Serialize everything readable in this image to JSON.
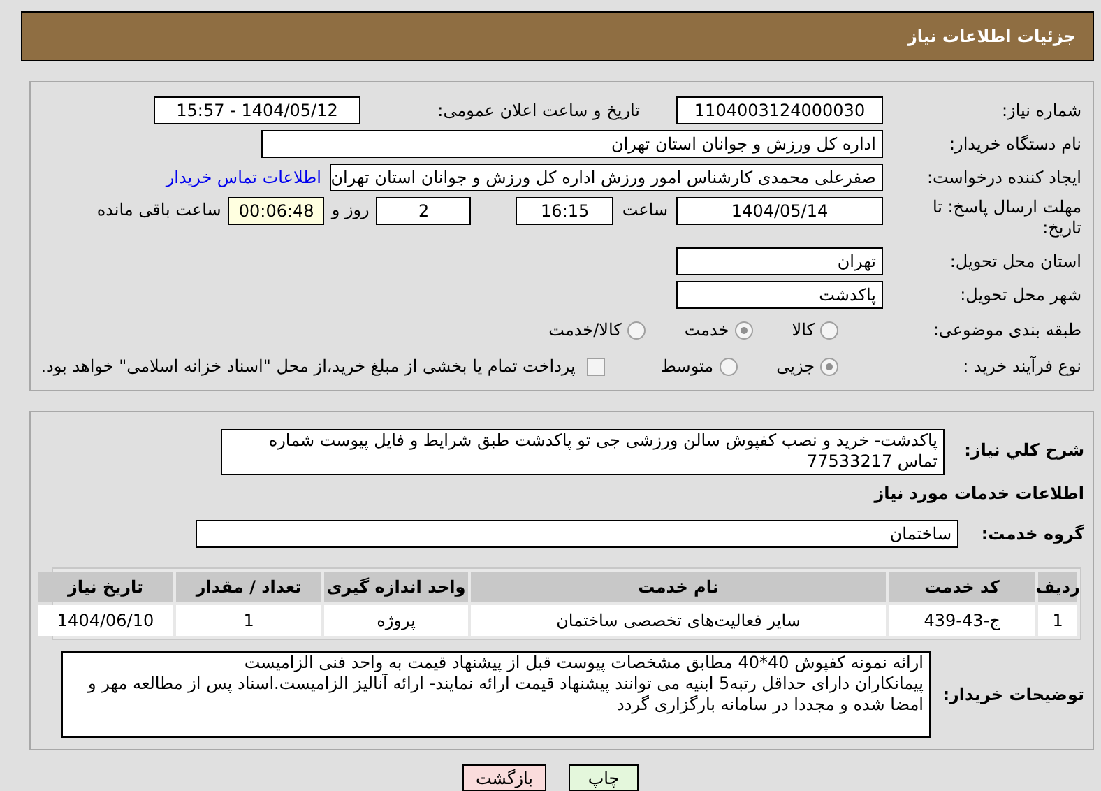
{
  "header": {
    "title": "جزئیات اطلاعات نیاز"
  },
  "need_number": {
    "label": "شماره نیاز:",
    "value": "1104003124000030"
  },
  "announce": {
    "label": "تاریخ و ساعت اعلان عمومی:",
    "value": "1404/05/12 - 15:57"
  },
  "buyer": {
    "label": "نام دستگاه خریدار:",
    "value": "اداره کل ورزش و جوانان استان تهران"
  },
  "creator": {
    "label": "ایجاد کننده درخواست:",
    "value": "صفرعلی محمدی کارشناس امور ورزش اداره کل ورزش و جوانان استان تهران",
    "link": "اطلاعات تماس خریدار"
  },
  "deadline": {
    "label": "مهلت ارسال پاسخ: تا تاریخ:",
    "date": "1404/05/14",
    "time_label": "ساعت",
    "time": "16:15",
    "days": "2",
    "days_label": "روز و",
    "remaining": "00:06:48",
    "remaining_label": "ساعت باقی مانده"
  },
  "province": {
    "label": "استان محل تحویل:",
    "value": "تهران"
  },
  "city": {
    "label": "شهر محل تحویل:",
    "value": "پاکدشت"
  },
  "category": {
    "label": "طبقه بندی موضوعی:",
    "options": [
      {
        "label": "کالا",
        "selected": false
      },
      {
        "label": "خدمت",
        "selected": true
      },
      {
        "label": "کالا/خدمت",
        "selected": false
      }
    ]
  },
  "process": {
    "label": "نوع فرآیند خرید :",
    "options": [
      {
        "label": "جزیی",
        "selected": true
      },
      {
        "label": "متوسط",
        "selected": false
      }
    ],
    "payment": {
      "label": "پرداخت تمام یا بخشی از مبلغ خرید،از محل \"اسناد خزانه اسلامی\" خواهد بود.",
      "checked": false
    }
  },
  "description": {
    "label": "شرح کلي نیاز:",
    "value": "پاکدشت- خرید و نصب کفپوش سالن ورزشی جی تو پاکدشت طبق شرایط و فایل پیوست شماره تماس 77533217"
  },
  "services_heading": "اطلاعات خدمات مورد نیاز",
  "service_group": {
    "label": "گروه خدمت:",
    "value": "ساختمان"
  },
  "table": {
    "columns": [
      "ردیف",
      "کد خدمت",
      "نام خدمت",
      "واحد اندازه گیری",
      "تعداد / مقدار",
      "تاریخ نیاز"
    ],
    "rows": [
      [
        "1",
        "ج-43-439",
        "سایر فعالیت‌های تخصصی ساختمان",
        "پروژه",
        "1",
        "1404/06/10"
      ]
    ]
  },
  "buyer_notes": {
    "label": "توضیحات خریدار:",
    "value": "ارائه نمونه کفپوش 40*40 مطابق مشخصات پیوست قبل از پیشنهاد قیمت به واحد فنی الزامیست\nپیمانکاران دارای حداقل رتبه5 ابنیه می توانند پیشنهاد قیمت ارائه نمایند- ارائه آنالیز الزامیست.اسناد پس از مطالعه مهر و امضا شده و مجددا در سامانه بارگزاری گردد"
  },
  "buttons": {
    "print": "چاپ",
    "back": "بازگشت"
  }
}
